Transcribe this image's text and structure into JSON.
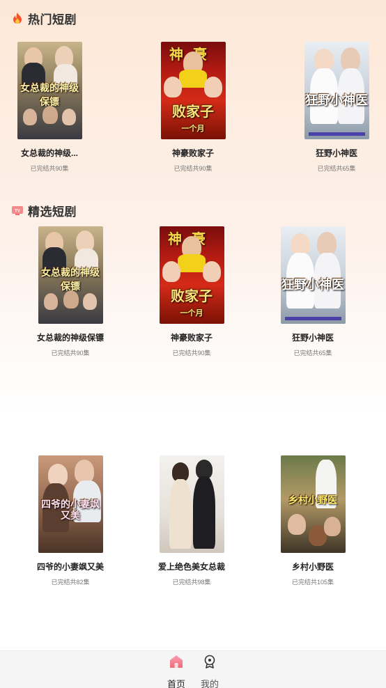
{
  "hot": {
    "title": "热门短剧",
    "icon": "fire-icon",
    "items": [
      {
        "title": "女总裁的神级...",
        "sub": "已完结共90集",
        "poster_text": "女总裁的神级保镖"
      },
      {
        "title": "神豪败家子",
        "sub": "已完结共90集",
        "poster_text": "败家子"
      },
      {
        "title": "狂野小神医",
        "sub": "已完结共65集",
        "poster_text": "狂野小神医"
      }
    ]
  },
  "featured": {
    "title": "精选短剧",
    "icon": "tv-icon",
    "items": [
      {
        "title": "女总裁的神级保镖",
        "sub": "已完结共90集",
        "poster_text": "女总裁的神级保镖"
      },
      {
        "title": "神豪败家子",
        "sub": "已完结共90集",
        "poster_text": "败家子"
      },
      {
        "title": "狂野小神医",
        "sub": "已完结共65集",
        "poster_text": "狂野小神医"
      },
      {
        "title": "四爷的小妻飒又美",
        "sub": "已完结共82集",
        "poster_text": "四爷的小妻飒又美"
      },
      {
        "title": "爱上绝色美女总裁",
        "sub": "已完结共98集",
        "poster_text": ""
      },
      {
        "title": "乡村小野医",
        "sub": "已完结共105集",
        "poster_text": "乡村小野医"
      }
    ]
  },
  "tabbar": {
    "home": {
      "label": "首页",
      "icon": "home-icon"
    },
    "mine": {
      "label": "我的",
      "icon": "profile-icon"
    }
  },
  "colors": {
    "accent": "#f06a7a",
    "fire": "#f2542d"
  }
}
